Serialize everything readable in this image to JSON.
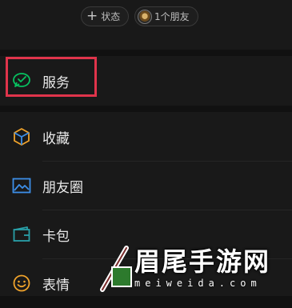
{
  "status_bar": {
    "status_button": {
      "icon": "plus-icon",
      "label": "状态"
    },
    "friends_button": {
      "label": "1个朋友"
    }
  },
  "menu": {
    "items": [
      {
        "label": "服务",
        "icon": "wechat-pay-icon",
        "color": "#07c160"
      },
      {
        "label": "收藏",
        "icon": "cube-icon",
        "color": "#f0a32b"
      },
      {
        "label": "朋友圈",
        "icon": "image-icon",
        "color": "#3d8fe8"
      },
      {
        "label": "卡包",
        "icon": "wallet-icon",
        "color": "#29a0a8"
      },
      {
        "label": "表情",
        "icon": "smiley-icon",
        "color": "#f0a32b"
      }
    ]
  },
  "annotation": {
    "highlight_color": "#e0344b"
  },
  "watermark": {
    "title": "眉尾手游网",
    "subtitle": "meiweida.com"
  }
}
